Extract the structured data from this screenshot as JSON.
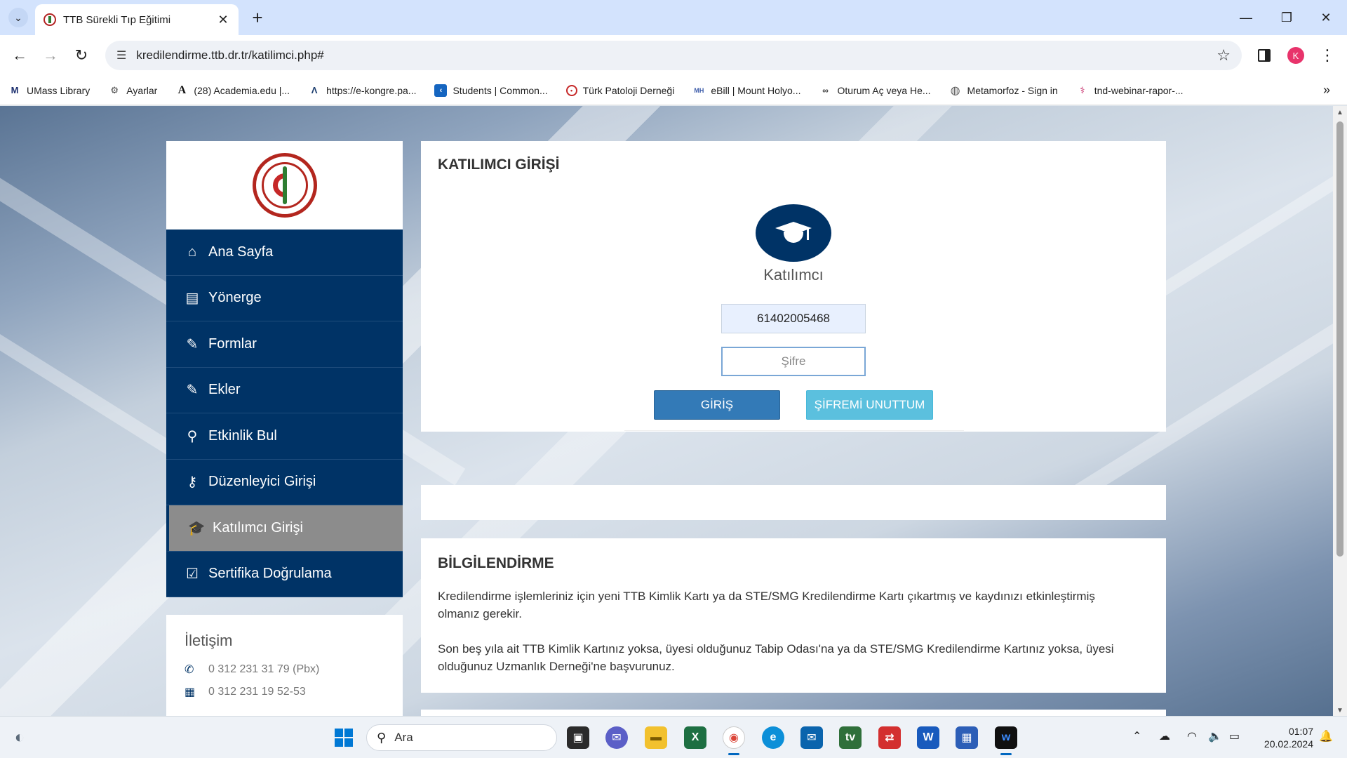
{
  "browser": {
    "tab_title": "TTB Sürekli Tıp Eğitimi",
    "url": "kredilendirme.ttb.dr.tr/katilimci.php#",
    "profile_initial": "K",
    "bookmarks": [
      {
        "label": "UMass Library",
        "icon": "umass-icon"
      },
      {
        "label": "Ayarlar",
        "icon": "gear-icon"
      },
      {
        "label": "(28) Academia.edu |...",
        "icon": "academia-icon"
      },
      {
        "label": "https://e-kongre.pa...",
        "icon": "ekongre-icon"
      },
      {
        "label": "Students | Common...",
        "icon": "commonapp-icon"
      },
      {
        "label": "Türk Patoloji Derneği",
        "icon": "patoloji-icon"
      },
      {
        "label": "eBill | Mount Holyo...",
        "icon": "ebill-icon"
      },
      {
        "label": "Oturum Aç veya He...",
        "icon": "link-icon"
      },
      {
        "label": "Metamorfoz - Sign in",
        "icon": "globe-icon"
      },
      {
        "label": "tnd-webinar-rapor-...",
        "icon": "tnd-icon"
      }
    ]
  },
  "sidebar": {
    "menu": [
      {
        "label": "Ana Sayfa",
        "icon": "home-icon",
        "glyph": "⌂"
      },
      {
        "label": "Yönerge",
        "icon": "book-icon",
        "glyph": "▤"
      },
      {
        "label": "Formlar",
        "icon": "edit-icon",
        "glyph": "✎"
      },
      {
        "label": "Ekler",
        "icon": "edit-icon",
        "glyph": "✎"
      },
      {
        "label": "Etkinlik Bul",
        "icon": "search-icon",
        "glyph": "⚲"
      },
      {
        "label": "Düzenleyici Girişi",
        "icon": "key-icon",
        "glyph": "⚷"
      },
      {
        "label": "Katılımcı Girişi",
        "icon": "graduation-cap-icon",
        "glyph": "🎓",
        "active": true
      },
      {
        "label": "Sertifika Doğrulama",
        "icon": "check-square-icon",
        "glyph": "☑"
      }
    ],
    "contact": {
      "title": "İletişim",
      "phone": "0 312 231 31 79 (Pbx)",
      "fax": "0 312 231 19 52-53"
    }
  },
  "login": {
    "title": "KATILIMCI GİRİŞİ",
    "role_label": "Katılımcı",
    "username_value": "61402005468",
    "password_placeholder": "Şifre",
    "login_button": "GİRİŞ",
    "forgot_button": "ŞİFREMİ UNUTTUM"
  },
  "info": {
    "title": "BİLGİLENDİRME",
    "paragraph1": "Kredilendirme işlemleriniz için yeni TTB Kimlik Kartı ya da STE/SMG Kredilendirme Kartı çıkartmış ve kaydınızı etkinleştirmiş olmanız gerekir.",
    "paragraph2": "Son beş yıla ait TTB Kimlik Kartınız yoksa, üyesi olduğunuz Tabip Odası'na ya da STE/SMG Kredilendirme Kartınız yoksa, üyesi olduğunuz Uzmanlık Derneği'ne başvurunuz."
  },
  "taskbar": {
    "search_placeholder": "Ara",
    "time": "01:07",
    "date": "20.02.2024"
  },
  "colors": {
    "nav_blue": "#003366",
    "active_gray": "#8c8c8c",
    "primary_button": "#337ab7",
    "info_button": "#5bc0de"
  }
}
